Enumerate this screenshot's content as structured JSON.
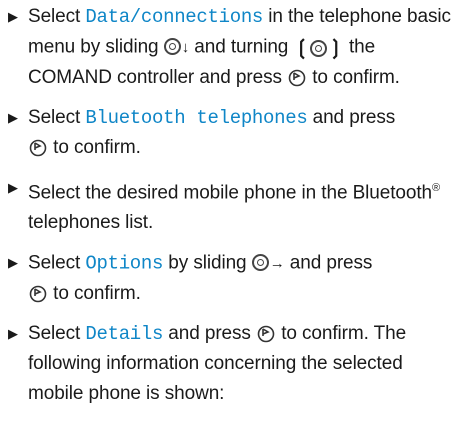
{
  "bullet_glyph": "▶",
  "steps": [
    {
      "pre": "Select ",
      "kw": "Data/connections",
      "mid1": " in the telephone basic menu by sliding ",
      "mid2": " and turning ",
      "mid3": " the COMAND controller and press ",
      "post": " to confirm."
    },
    {
      "pre": "Select ",
      "kw": "Bluetooth telephones",
      "mid": " and press ",
      "post": " to confirm."
    },
    {
      "text": "Select the desired mobile phone in the Bluetooth",
      "sup": "®",
      "text2": " telephones list."
    },
    {
      "pre": "Select ",
      "kw": "Options",
      "mid1": " by sliding ",
      "mid2": " and press ",
      "post": " to confirm."
    },
    {
      "pre": "Select ",
      "kw": "Details",
      "mid": " and press ",
      "post": " to confirm. The following information concerning the selected mobile phone is shown:"
    }
  ],
  "icons": {
    "slide_down": "controller-slide-down-icon",
    "turn": "controller-turn-icon",
    "press": "controller-press-icon",
    "slide_right": "controller-slide-right-icon"
  }
}
